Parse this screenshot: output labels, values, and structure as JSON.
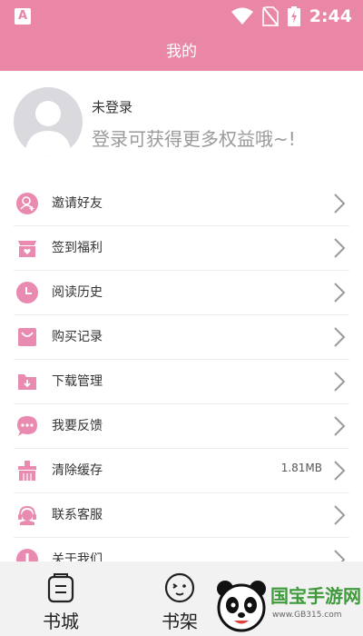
{
  "status": {
    "app_badge": "A",
    "time": "2:44"
  },
  "header": {
    "title": "我的"
  },
  "profile": {
    "name": "未登录",
    "subtitle": "登录可获得更多权益哦~!"
  },
  "menu": [
    {
      "label": "邀请好友",
      "icon": "invite-friends-icon"
    },
    {
      "label": "签到福利",
      "icon": "checkin-gift-icon"
    },
    {
      "label": "阅读历史",
      "icon": "clock-icon"
    },
    {
      "label": "购买记录",
      "icon": "shopping-bag-icon"
    },
    {
      "label": "下载管理",
      "icon": "download-folder-icon"
    },
    {
      "label": "我要反馈",
      "icon": "chat-bubble-icon"
    },
    {
      "label": "清除缓存",
      "icon": "broom-icon",
      "value": "1.81MB"
    },
    {
      "label": "联系客服",
      "icon": "headset-icon"
    },
    {
      "label": "关于我们",
      "icon": "info-icon"
    }
  ],
  "tabs": [
    {
      "label": "书城",
      "icon": "bookstore-icon"
    },
    {
      "label": "书架",
      "icon": "bookshelf-icon"
    }
  ],
  "watermark": {
    "text": "国宝手游网",
    "url": "www.GB315.com"
  },
  "colors": {
    "accent": "#ea86a6",
    "icon_pink": "#e98bb0"
  }
}
